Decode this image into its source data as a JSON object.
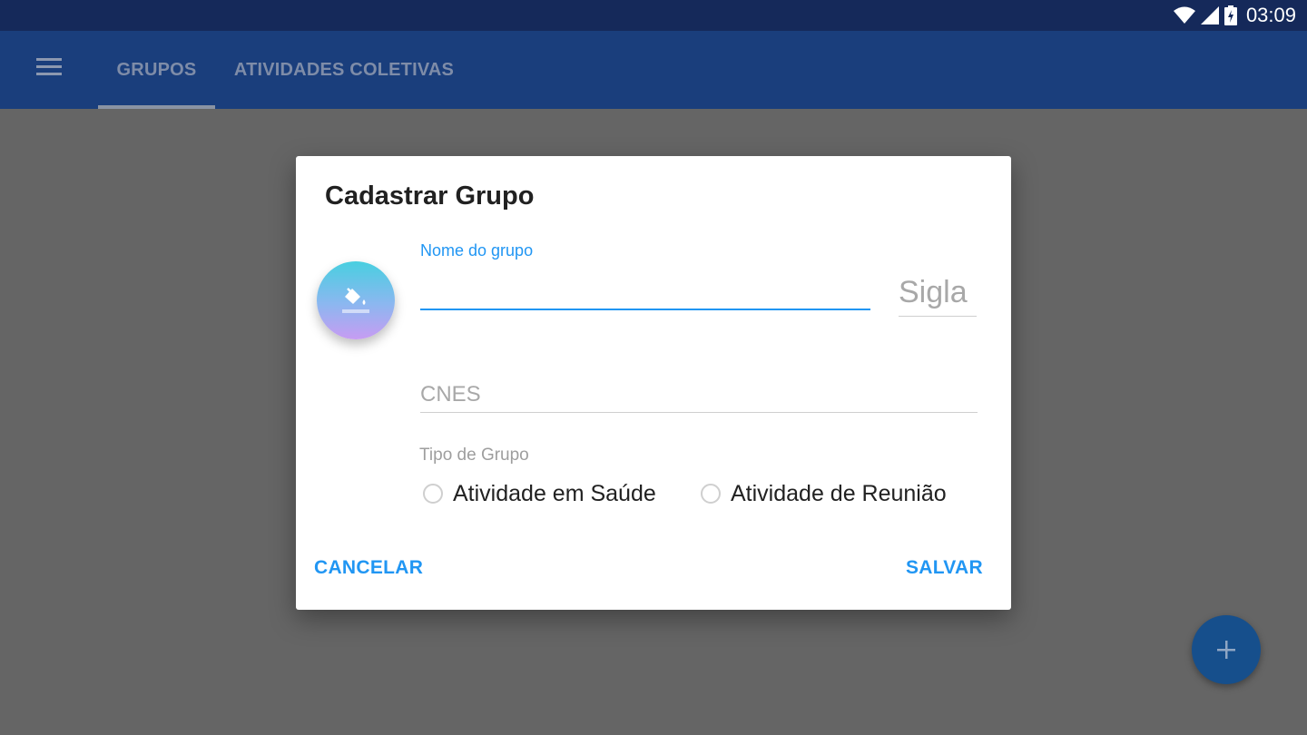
{
  "status_bar": {
    "time": "03:09"
  },
  "tabs": [
    {
      "label": "GRUPOS",
      "selected": true
    },
    {
      "label": "ATIVIDADES COLETIVAS",
      "selected": false
    }
  ],
  "fab": {
    "icon": "plus-icon"
  },
  "dialog": {
    "title": "Cadastrar Grupo",
    "avatar_icon": "paint-bucket-icon",
    "nome_label": "Nome do grupo",
    "nome_value": "",
    "sigla_placeholder": "Sigla",
    "cnes_placeholder": "CNES",
    "tipo_label": "Tipo de Grupo",
    "tipo_options": [
      {
        "label": "Atividade em Saúde",
        "selected": false
      },
      {
        "label": "Atividade de Reunião",
        "selected": false
      }
    ],
    "cancel_label": "CANCELAR",
    "save_label": "SALVAR"
  },
  "colors": {
    "accent": "#2196f3",
    "app_bar": "#1a3e7c",
    "status_bar": "#15295a",
    "scrim": "#656565"
  }
}
